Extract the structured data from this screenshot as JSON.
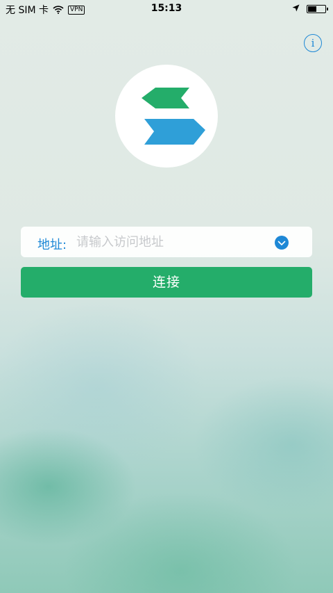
{
  "status_bar": {
    "carrier": "无 SIM 卡",
    "vpn": "VPN",
    "time": "15:13",
    "battery_level": 0.55
  },
  "header": {
    "info_icon": "info-icon",
    "info_glyph": "i"
  },
  "logo": {
    "icon": "app-logo-icon",
    "colors": {
      "top_chevron": "#24ad6a",
      "bottom_chevron": "#2f9fd8",
      "background": "#ffffff"
    }
  },
  "address": {
    "label": "地址:",
    "value": "",
    "placeholder": "请输入访问地址",
    "dropdown_icon": "chevron-down-icon"
  },
  "actions": {
    "connect_label": "连接"
  },
  "colors": {
    "accent": "#1e88d6",
    "primary_button": "#24ad6a"
  }
}
